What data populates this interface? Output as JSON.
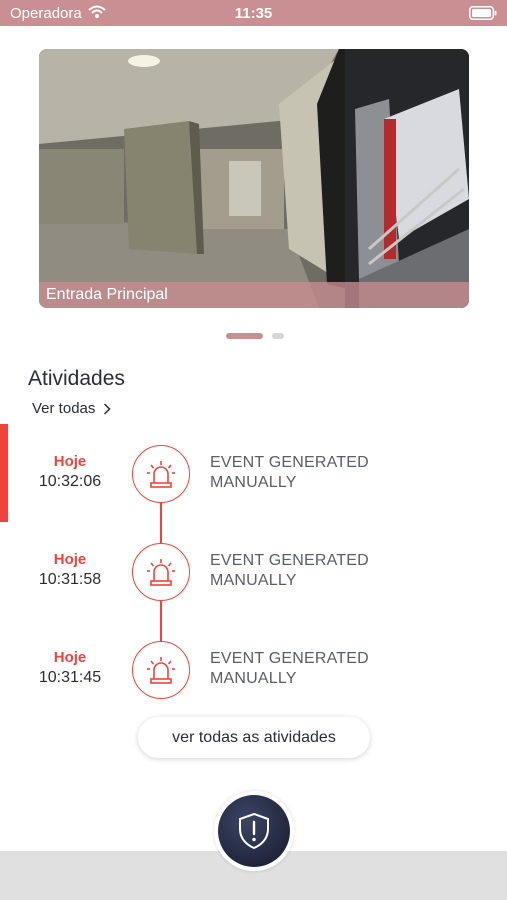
{
  "status_bar": {
    "carrier": "Operadora",
    "time": "11:35",
    "wifi_icon": "wifi-icon",
    "battery_icon": "battery-icon"
  },
  "camera": {
    "caption": "Entrada Principal",
    "page_count": 2,
    "active_page": 1
  },
  "activities": {
    "title": "Atividades",
    "see_all": "Ver todas",
    "items": [
      {
        "day": "Hoje",
        "time": "10:32:06",
        "line1": "EVENT GENERATED",
        "line2": "MANUALLY",
        "icon": "siren-icon"
      },
      {
        "day": "Hoje",
        "time": "10:31:58",
        "line1": "EVENT GENERATED",
        "line2": "MANUALLY",
        "icon": "siren-icon"
      },
      {
        "day": "Hoje",
        "time": "10:31:45",
        "line1": "EVENT GENERATED",
        "line2": "MANUALLY",
        "icon": "siren-icon"
      }
    ],
    "more_button": "ver todas as atividades"
  },
  "panic": {
    "icon": "shield-alert-icon"
  },
  "colors": {
    "accent": "#f0443a",
    "brand": "#c98f92",
    "dark": "#1d2236"
  }
}
